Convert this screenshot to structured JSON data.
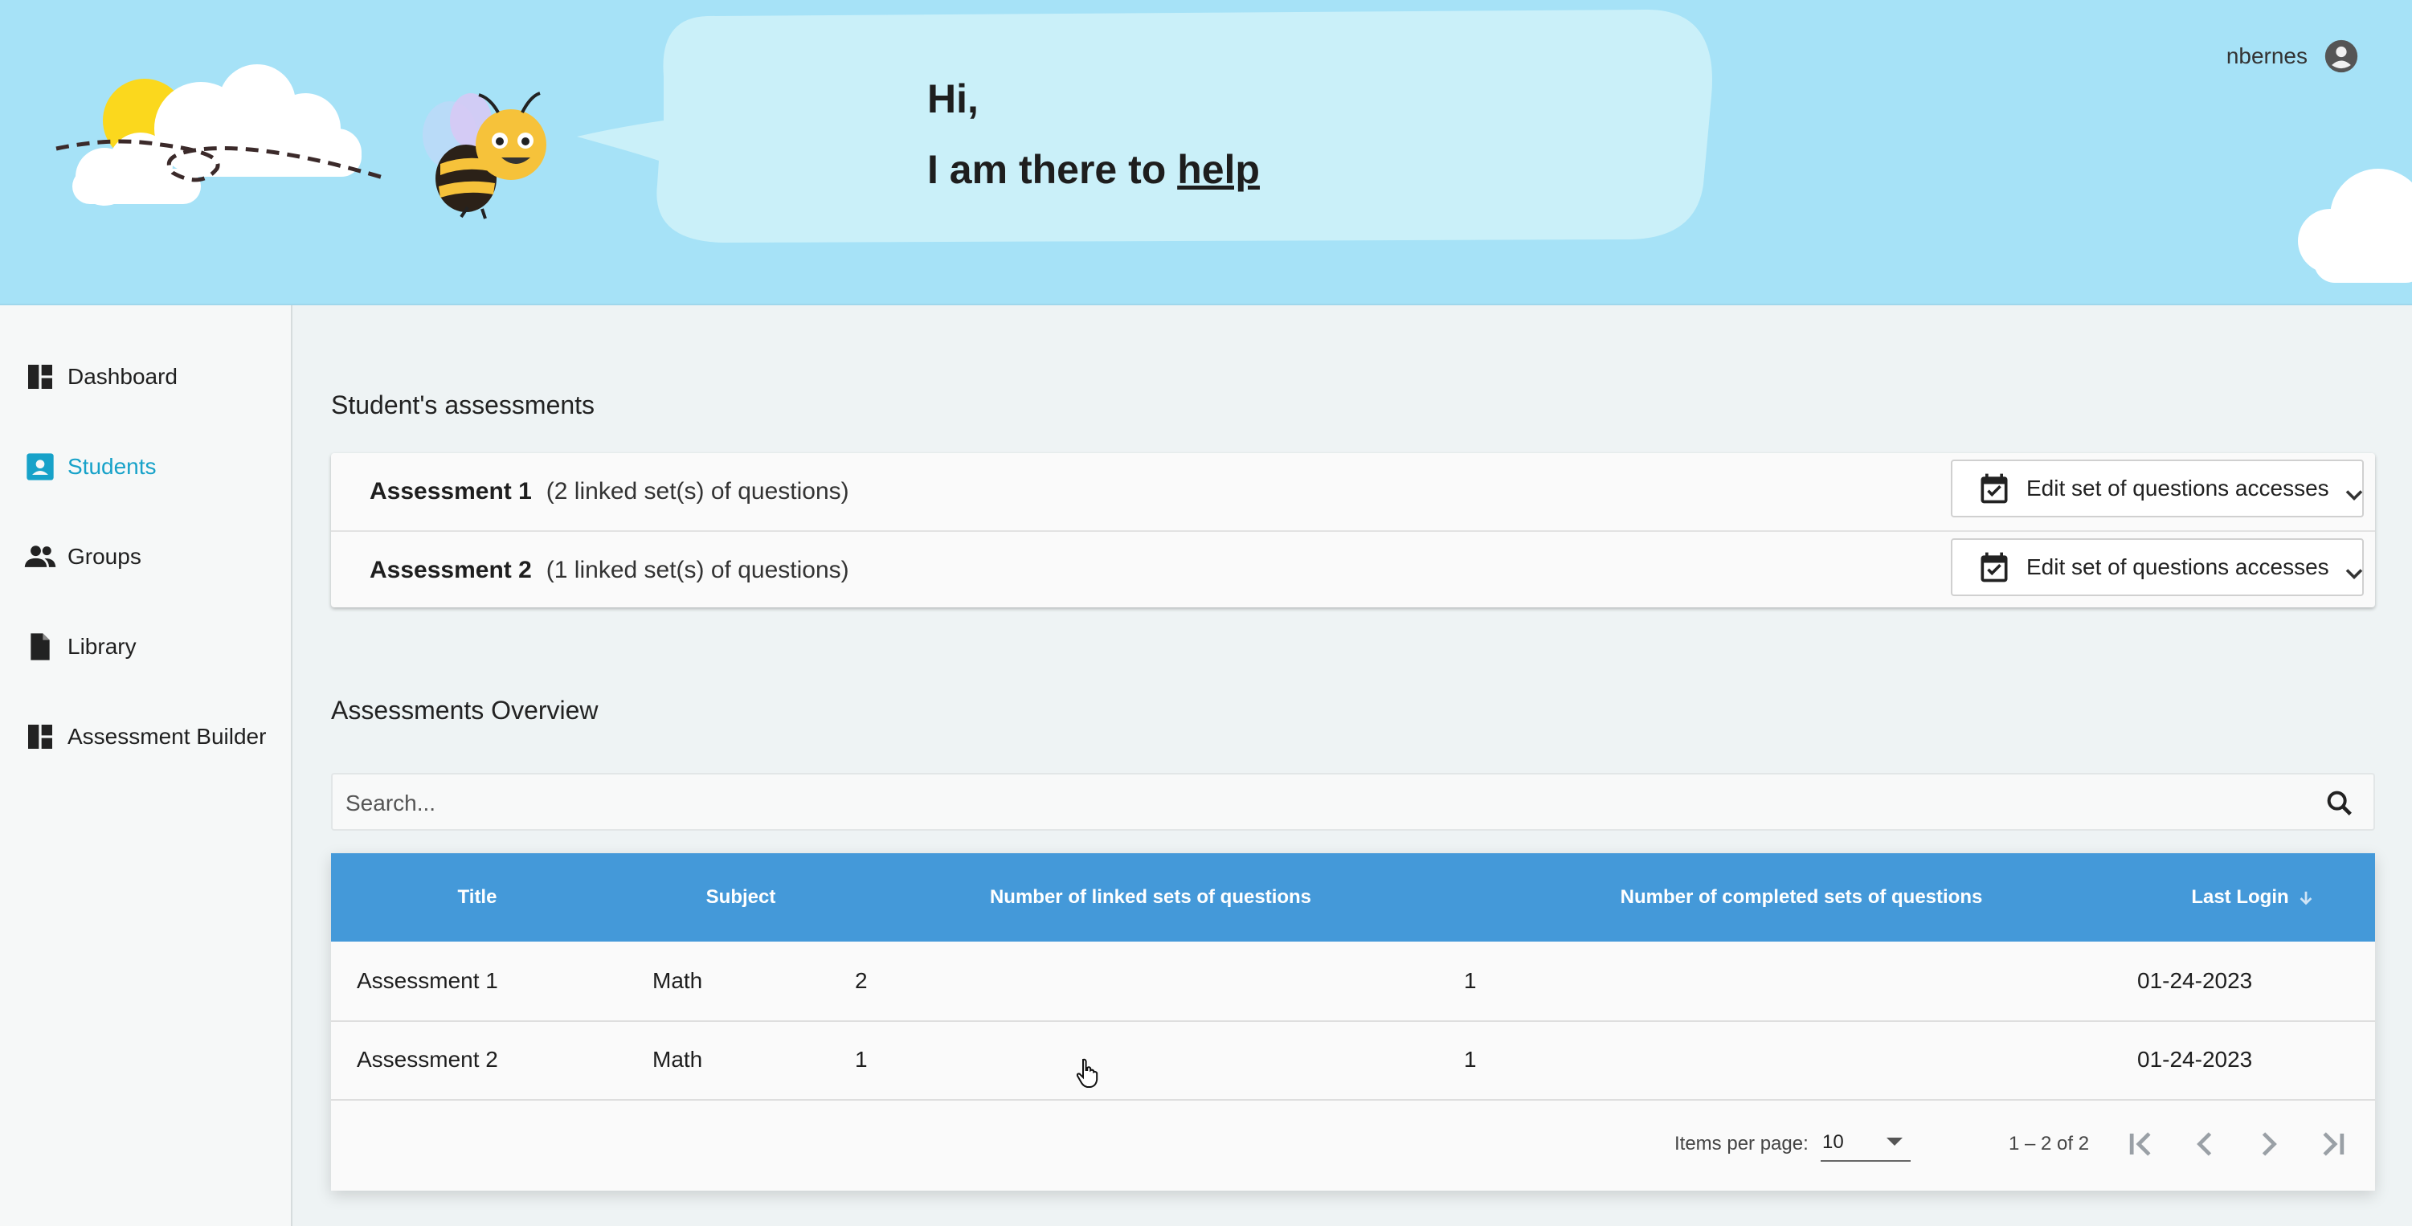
{
  "header": {
    "greeting_line1": "Hi,",
    "greeting_prefix": "I am there to ",
    "help_link": "help",
    "username": "nbernes",
    "user_icon": "account-circle-icon"
  },
  "sidebar": {
    "items": [
      {
        "label": "Dashboard",
        "icon": "dashboard-icon",
        "active": false
      },
      {
        "label": "Students",
        "icon": "student-badge-icon",
        "active": true
      },
      {
        "label": "Groups",
        "icon": "groups-icon",
        "active": false
      },
      {
        "label": "Library",
        "icon": "document-icon",
        "active": false
      },
      {
        "label": "Assessment Builder",
        "icon": "dashboard-icon",
        "active": false
      }
    ]
  },
  "assessments_section": {
    "title": "Student's assessments",
    "items": [
      {
        "name": "Assessment 1",
        "description": "(2 linked set(s) of questions)",
        "button": "Edit set of questions accesses"
      },
      {
        "name": "Assessment 2",
        "description": "(1 linked set(s) of questions)",
        "button": "Edit set of questions accesses"
      }
    ]
  },
  "overview": {
    "title": "Assessments Overview",
    "search_placeholder": "Search...",
    "columns": [
      "Title",
      "Subject",
      "Number of linked sets of questions",
      "Number of completed sets of questions",
      "Last Login"
    ],
    "sorted_column": "Last Login",
    "rows": [
      [
        "Assessment 1",
        "Math",
        "2",
        "1",
        "01-24-2023"
      ],
      [
        "Assessment 2",
        "Math",
        "1",
        "1",
        "01-24-2023"
      ]
    ],
    "paginator": {
      "items_per_page_label": "Items per page:",
      "items_per_page": "10",
      "range": "1 – 2 of 2"
    }
  },
  "colors": {
    "header_bg": "#a6e2f7",
    "accent": "#17a2c9",
    "table_header": "#4499d9"
  }
}
